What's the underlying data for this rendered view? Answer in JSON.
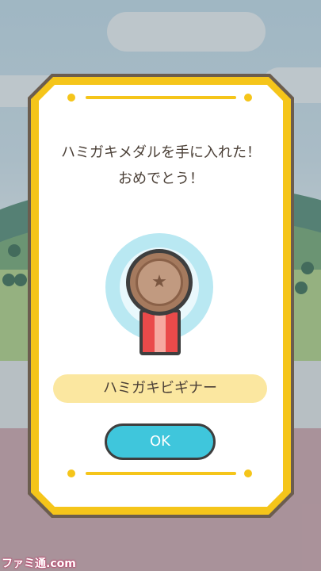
{
  "dialog": {
    "message_line1": "ハミガキメダルを手に入れた！",
    "message_line2": "おめでとう！",
    "medal_name": "ハミガキビギナー",
    "ok_label": "OK",
    "medal_icon": "bronze-star-medal-icon"
  },
  "watermark": "ファミ通.com",
  "colors": {
    "frame_gold": "#f5c51a",
    "frame_brown": "#6b5d4f",
    "button_cyan": "#3fc6dc",
    "label_yellow": "#fbe7a0",
    "medal_bronze": "#a57a5e",
    "ribbon_red": "#ea4a4a"
  }
}
